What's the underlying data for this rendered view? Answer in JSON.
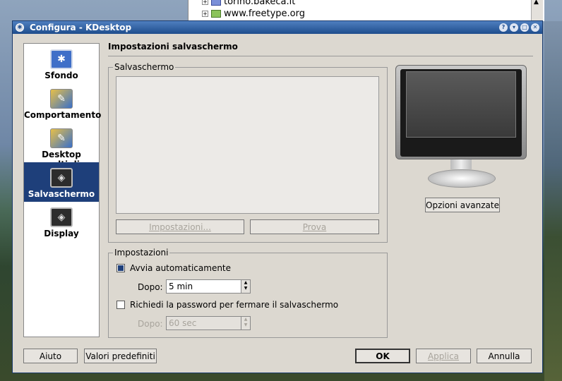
{
  "background": {
    "tree_items": [
      "torino.bakeca.it",
      "www.freetype.org"
    ]
  },
  "window": {
    "title": "Configura - KDesktop",
    "titlebar_buttons": [
      "help-icon",
      "shade-icon",
      "maximize-icon",
      "close-icon"
    ]
  },
  "sidebar": {
    "items": [
      {
        "label": "Sfondo",
        "icon": "background-icon",
        "active": false
      },
      {
        "label": "Comportamento",
        "icon": "behavior-icon",
        "active": false
      },
      {
        "label": "Desktop multipli",
        "icon": "multiple-desktops-icon",
        "active": false
      },
      {
        "label": "Salvaschermo",
        "icon": "screensaver-icon",
        "active": true
      },
      {
        "label": "Display",
        "icon": "display-icon",
        "active": false
      }
    ]
  },
  "main": {
    "title": "Impostazioni salvaschermo",
    "screensaver_group": {
      "label": "Salvaschermo",
      "settings_button": "Impostazioni...",
      "test_button": "Prova"
    },
    "advanced_button": "Opzioni avanzate",
    "settings_group": {
      "label": "Impostazioni",
      "autostart_label": "Avvia automaticamente",
      "autostart_checked": true,
      "after_label": "Dopo:",
      "after_value": "5 min",
      "password_label": "Richiedi la password per fermare il salvaschermo",
      "password_checked": false,
      "password_after_label": "Dopo:",
      "password_after_value": "60 sec"
    }
  },
  "footer": {
    "help_button": "Aiuto",
    "defaults_button": "Valori predefiniti",
    "ok_button": "OK",
    "apply_button": "Applica",
    "cancel_button": "Annulla"
  },
  "colors": {
    "titlebar": "#1e4d8d",
    "selection": "#1e3f7a",
    "window_bg": "#dcd8d0"
  }
}
